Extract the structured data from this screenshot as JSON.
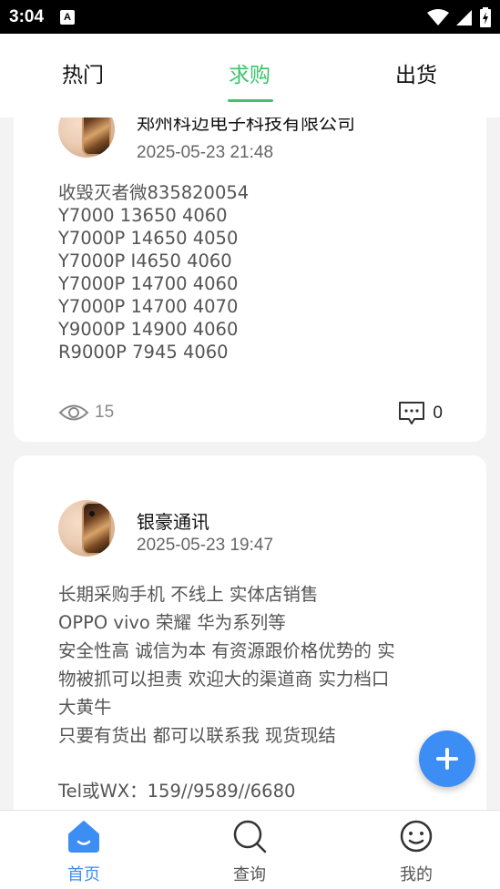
{
  "status_bar": {
    "time": "3:04",
    "indicator": "A"
  },
  "tabs": [
    {
      "label": "热门"
    },
    {
      "label": "求购"
    },
    {
      "label": "出货"
    }
  ],
  "active_tab": "求购",
  "posts": [
    {
      "author": "郑州科迈电子科技有限公司",
      "time": "2025-05-23 21:48",
      "body": "收毁灭者微835820054\nY7000 13650 4060\nY7000P 14650 4050\nY7000P I4650 4060\nY7000P 14700 4060\nY7000P 14700 4070\nY9000P 14900 4060\nR9000P 7945 4060",
      "views": "15",
      "comments": "0"
    },
    {
      "author": "银豪通讯",
      "time": "2025-05-23 19:47",
      "body": "长期采购手机  不线上 实体店销售\nOPPO vivo 荣耀 华为系列等\n安全性高 诚信为本 有资源跟价格优势的 实\n物被抓可以担责 欢迎大的渠道商 实力档口\n大黄牛\n只要有货出  都可以联系我 现货现结",
      "contact": "Tel或WX：159//9589//6680"
    }
  ],
  "bottom_nav": [
    {
      "label": "首页",
      "icon": "home-icon"
    },
    {
      "label": "查询",
      "icon": "search-icon"
    },
    {
      "label": "我的",
      "icon": "smile-icon"
    }
  ],
  "colors": {
    "accent_green": "#3cc56b",
    "accent_blue": "#3d8ef4"
  }
}
